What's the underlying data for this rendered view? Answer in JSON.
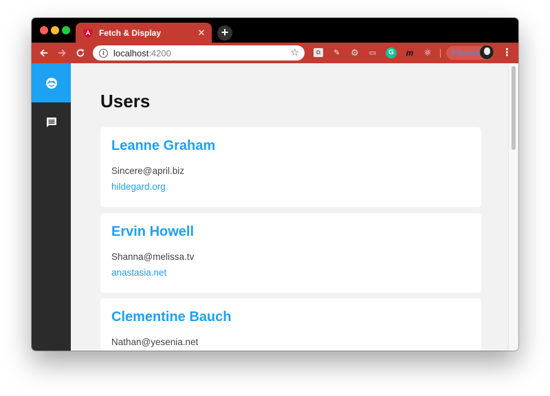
{
  "browser": {
    "tab": {
      "title": "Fetch & Display",
      "close": "✕",
      "favicon": "angular-icon"
    },
    "new_tab": "+",
    "url": {
      "host": "localhost",
      "port": ":4200"
    },
    "profile_status": "Paused",
    "extensions": [
      "screenshot-icon",
      "dropper-icon",
      "gear-icon",
      "window-icon",
      "grammarly-icon",
      "m-icon",
      "react-icon"
    ]
  },
  "sidebar": {
    "items": [
      {
        "name": "users",
        "icon": "face-icon",
        "active": true
      },
      {
        "name": "posts",
        "icon": "message-icon",
        "active": false
      }
    ],
    "active_color": "#1da1f2",
    "background": "#2b2b2b"
  },
  "main": {
    "title": "Users",
    "users": [
      {
        "name": "Leanne Graham",
        "email": "Sincere@april.biz",
        "website": "hildegard.org"
      },
      {
        "name": "Ervin Howell",
        "email": "Shanna@melissa.tv",
        "website": "anastasia.net"
      },
      {
        "name": "Clementine Bauch",
        "email": "Nathan@yesenia.net",
        "website": ""
      }
    ]
  },
  "colors": {
    "accent": "#1da1f2",
    "browser_theme": "#c43b32"
  }
}
